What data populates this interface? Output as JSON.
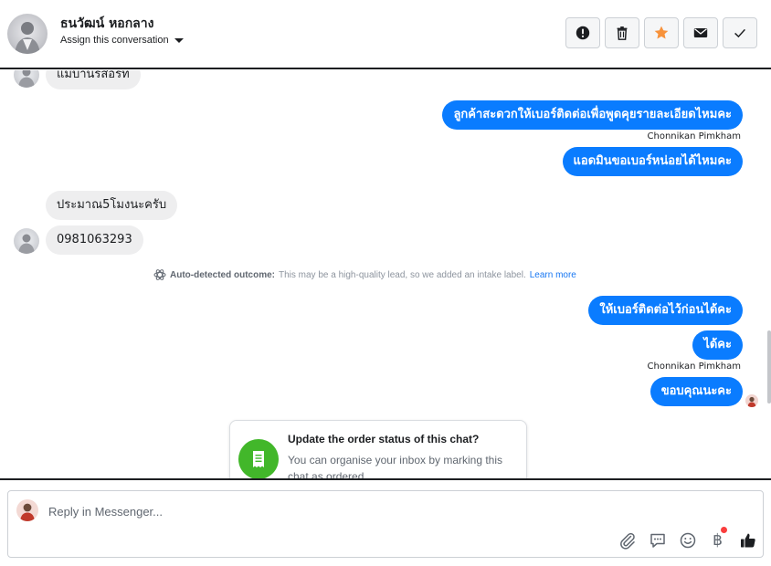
{
  "header": {
    "contact_name": "ธนวัฒน์ หอกลาง",
    "assign_label": "Assign this conversation",
    "toolbar": {
      "icons": [
        "exclamation-icon",
        "trash-icon",
        "star-icon",
        "envelope-icon",
        "check-icon"
      ],
      "star_color": "#f7923b"
    }
  },
  "messages": [
    {
      "side": "in",
      "text": "แม่บ้านรีสอร์ท"
    },
    {
      "side": "out",
      "text": "ลูกค้าสะดวกให้เบอร์ติดต่อเพื่อพูดคุยรายละเอียดไหมคะ"
    },
    {
      "side": "sender",
      "text": "Chonnikan Pimkham"
    },
    {
      "side": "out",
      "text": "แอดมินขอเบอร์หน่อยได้ไหมคะ"
    },
    {
      "side": "in",
      "text": "ประมาณ5โมงนะครับ"
    },
    {
      "side": "in",
      "text": "0981063293"
    },
    {
      "side": "out",
      "text": "ให้เบอร์ติดต่อไว้ก่อนได้คะ"
    },
    {
      "side": "out",
      "text": "ได้คะ"
    },
    {
      "side": "sender",
      "text": "Chonnikan Pimkham"
    },
    {
      "side": "out",
      "text": "ขอบคุณนะคะ"
    }
  ],
  "outcome": {
    "bold": "Auto-detected outcome:",
    "text": "This may be a high-quality lead, so we added an intake label.",
    "link": "Learn more"
  },
  "card": {
    "title": "Update the order status of this chat?",
    "text": "You can organise your inbox by marking this chat as ordered."
  },
  "composer": {
    "placeholder": "Reply in Messenger...",
    "currency_symbol": "฿",
    "accent": "#0a7cff"
  },
  "colors": {
    "outgoing_bubble": "#0a7cff",
    "incoming_bubble": "#eeeeef",
    "card_icon": "#42b72a"
  }
}
